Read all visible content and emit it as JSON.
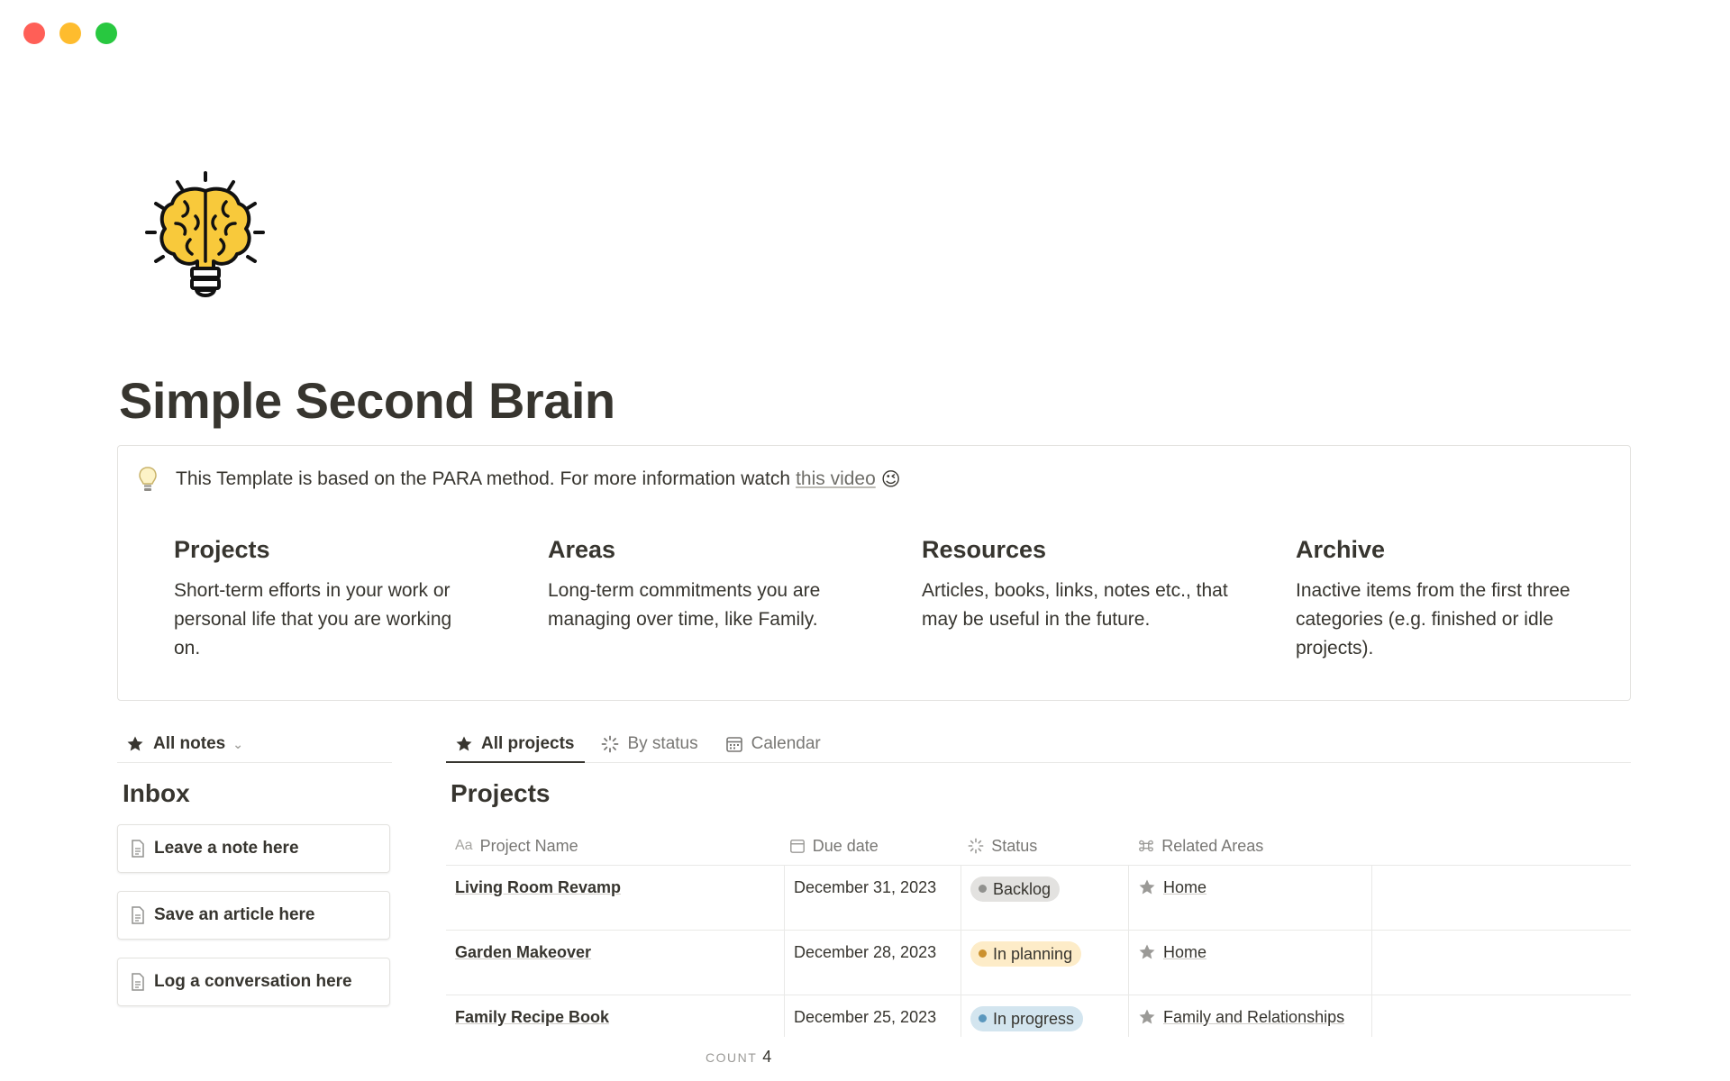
{
  "window": {
    "controls": [
      "close",
      "minimize",
      "zoom"
    ]
  },
  "page": {
    "icon": "brain-lightbulb-icon",
    "title": "Simple Second Brain"
  },
  "callout": {
    "icon": "lightbulb-icon",
    "text": "This Template is based on the PARA method. For more information watch",
    "link": "this video",
    "emoji": "😉",
    "columns": [
      {
        "title": "Projects",
        "body": "Short-term efforts in your work or personal life that you are working on."
      },
      {
        "title": "Areas",
        "body": "Long-term commitments you are managing over time, like Family."
      },
      {
        "title": "Resources",
        "body": "Articles, books, links, notes etc., that may be useful in the future."
      },
      {
        "title": "Archive",
        "body": "Inactive items from the first three categories (e.g. finished or idle projects)."
      }
    ]
  },
  "notes_panel": {
    "view_label": "All notes",
    "heading": "Inbox",
    "buttons": [
      "Leave a note here",
      "Save an article here",
      "Log a conversation here"
    ]
  },
  "projects_db": {
    "tabs": [
      "All projects",
      "By status",
      "Calendar"
    ],
    "heading": "Projects",
    "columns": {
      "name_prefix": "Aa",
      "name": "Project Name",
      "due": "Due date",
      "status": "Status",
      "areas": "Related Areas"
    },
    "rows": [
      {
        "name": "Living Room Revamp",
        "due": "December 31, 2023",
        "status": "Backlog",
        "area": "Home"
      },
      {
        "name": "Garden Makeover",
        "due": "December 28, 2023",
        "status": "In planning",
        "area": "Home"
      },
      {
        "name": "Family Recipe Book",
        "due": "December 25, 2023",
        "status": "In progress",
        "area": "Family and Relationships"
      }
    ],
    "count_label": "COUNT",
    "count": "4"
  },
  "colors": {
    "backlog_bg": "#e3e2e0",
    "backlog_dot": "#91918e",
    "planning_bg": "#fdecc8",
    "planning_dot": "#cb912f",
    "progress_bg": "#d3e5ef",
    "progress_dot": "#5b97bd"
  }
}
